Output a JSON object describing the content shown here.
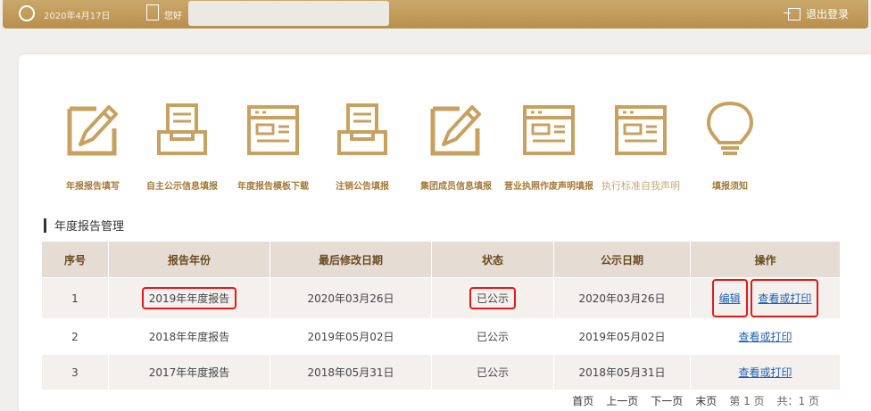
{
  "header": {
    "date": "2020年4月17日",
    "greeting": "您好",
    "logout_label": "退出登录"
  },
  "menu": [
    {
      "label": "年报报告填写",
      "icon": "pencil-frame-icon"
    },
    {
      "label": "自主公示信息填报",
      "icon": "inbox-tray-icon"
    },
    {
      "label": "年度报告模板下载",
      "icon": "document-template-icon"
    },
    {
      "label": "注销公告填报",
      "icon": "inbox-tray-icon"
    },
    {
      "label": "集团成员信息填报",
      "icon": "pencil-frame-icon"
    },
    {
      "label": "营业执照作废声明填报",
      "icon": "document-template-icon"
    },
    {
      "label": "执行标准自我声明",
      "icon": "document-template-icon"
    },
    {
      "label": "填报须知",
      "icon": "lightbulb-icon"
    }
  ],
  "section": {
    "title": "年度报告管理"
  },
  "table": {
    "headers": [
      "序号",
      "报告年份",
      "最后修改日期",
      "状态",
      "公示日期",
      "操作"
    ],
    "rows": [
      {
        "no": "1",
        "year": "2019年年度报告",
        "modified": "2020年03月26日",
        "status": "已公示",
        "publish": "2020年03月26日",
        "edit": "编辑",
        "view": "查看或打印"
      },
      {
        "no": "2",
        "year": "2018年年度报告",
        "modified": "2019年05月02日",
        "status": "已公示",
        "publish": "2019年05月02日",
        "view": "查看或打印"
      },
      {
        "no": "3",
        "year": "2017年年度报告",
        "modified": "2018年05月31日",
        "status": "已公示",
        "publish": "2018年05月31日",
        "view": "查看或打印"
      }
    ]
  },
  "pager": {
    "first": "首页",
    "prev": "上一页",
    "next": "下一页",
    "last": "末页",
    "current": "第 1 页",
    "total": "共：1 页"
  },
  "colors": {
    "accent": "#b98f4c",
    "icon": "#c8a060",
    "link": "#1d5fb4",
    "highlight": "#e31a1a"
  }
}
